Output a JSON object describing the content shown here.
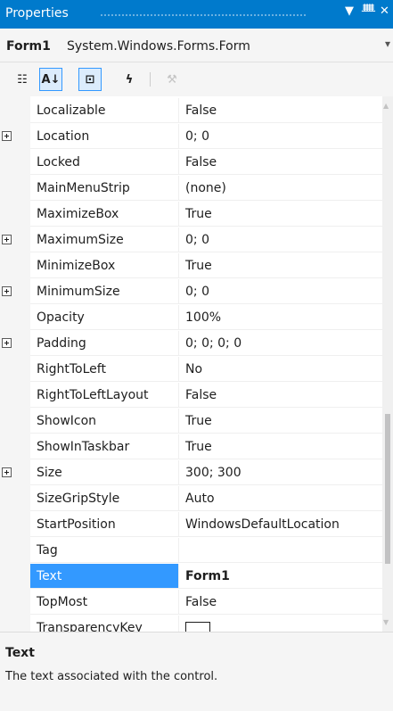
{
  "panel": {
    "title": "Properties",
    "dropdown_glyph": "▼",
    "pin_glyph": "ᚙ",
    "close_glyph": "✕"
  },
  "object": {
    "name": "Form1",
    "type": "System.Windows.Forms.Form",
    "drop_glyph": "▾"
  },
  "toolbar": {
    "categorized_icon": "categorized-icon",
    "alphabetical_icon": "alphabetical-icon",
    "properties_icon": "properties-icon",
    "events_icon": "events-icon",
    "property_pages_icon": "property-pages-icon",
    "categorized_glyph": "☷",
    "alphabetical_glyph": "A↓",
    "properties_glyph": "⊡",
    "events_glyph": "ϟ",
    "property_pages_glyph": "⚒"
  },
  "properties": [
    {
      "name": "Localizable",
      "value": "False",
      "expandable": false
    },
    {
      "name": "Location",
      "value": "0; 0",
      "expandable": true
    },
    {
      "name": "Locked",
      "value": "False",
      "expandable": false
    },
    {
      "name": "MainMenuStrip",
      "value": "(none)",
      "expandable": false
    },
    {
      "name": "MaximizeBox",
      "value": "True",
      "expandable": false
    },
    {
      "name": "MaximumSize",
      "value": "0; 0",
      "expandable": true
    },
    {
      "name": "MinimizeBox",
      "value": "True",
      "expandable": false
    },
    {
      "name": "MinimumSize",
      "value": "0; 0",
      "expandable": true
    },
    {
      "name": "Opacity",
      "value": "100%",
      "expandable": false
    },
    {
      "name": "Padding",
      "value": "0; 0; 0; 0",
      "expandable": true
    },
    {
      "name": "RightToLeft",
      "value": "No",
      "expandable": false
    },
    {
      "name": "RightToLeftLayout",
      "value": "False",
      "expandable": false
    },
    {
      "name": "ShowIcon",
      "value": "True",
      "expandable": false
    },
    {
      "name": "ShowInTaskbar",
      "value": "True",
      "expandable": false
    },
    {
      "name": "Size",
      "value": "300; 300",
      "expandable": true
    },
    {
      "name": "SizeGripStyle",
      "value": "Auto",
      "expandable": false
    },
    {
      "name": "StartPosition",
      "value": "WindowsDefaultLocation",
      "expandable": false
    },
    {
      "name": "Tag",
      "value": "",
      "expandable": false
    },
    {
      "name": "Text",
      "value": "Form1",
      "expandable": false,
      "selected": true
    },
    {
      "name": "TopMost",
      "value": "False",
      "expandable": false
    },
    {
      "name": "TransparencyKey",
      "value": "",
      "expandable": false,
      "color_swatch": "#ffffff"
    }
  ],
  "scrollbar": {
    "up_glyph": "▲",
    "down_glyph": "▼"
  },
  "description": {
    "title": "Text",
    "text": "The text associated with the control."
  },
  "colors": {
    "accent": "#007acc",
    "selection": "#3399ff"
  }
}
